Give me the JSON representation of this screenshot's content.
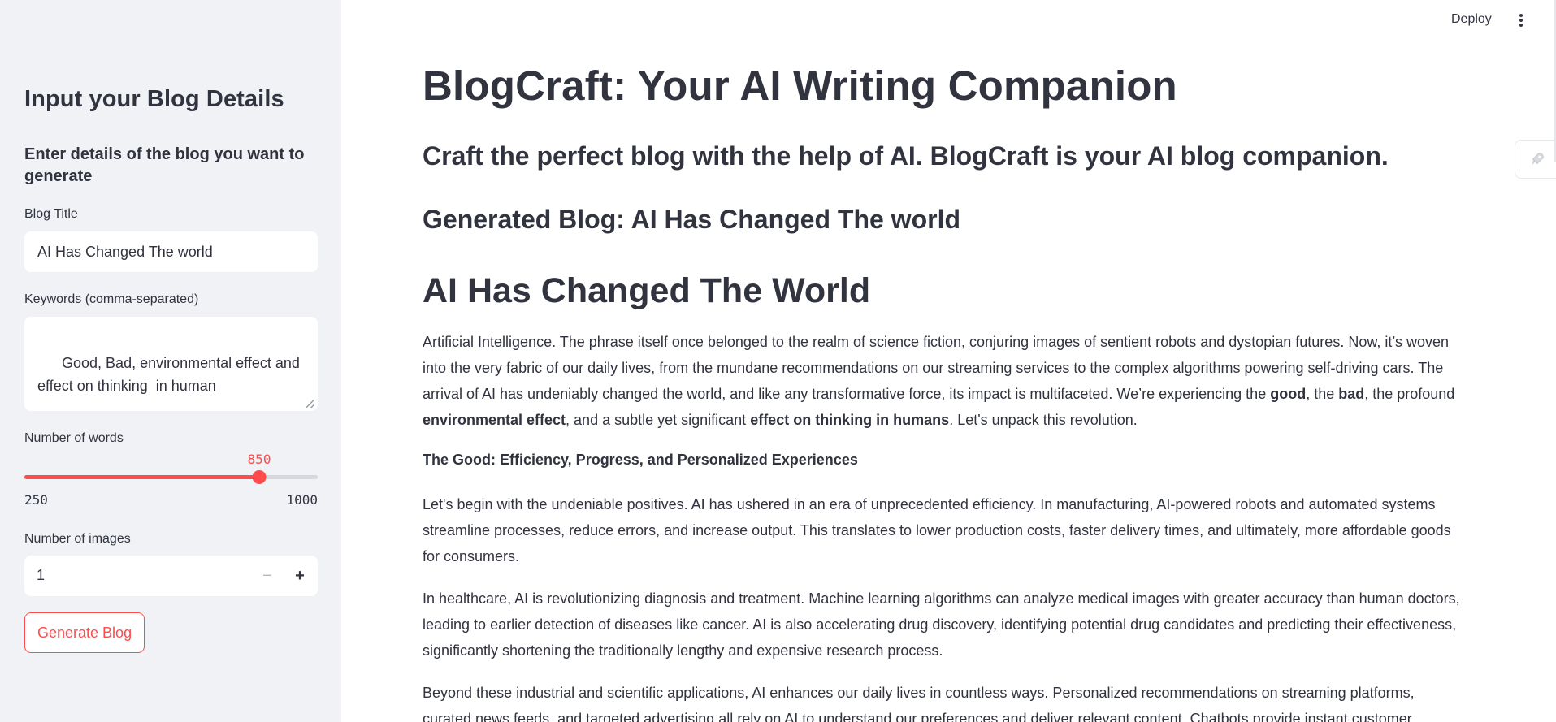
{
  "sidebar": {
    "title": "Input your Blog Details",
    "subtitle": "Enter details of the blog you want to generate",
    "blog_title_label": "Blog Title",
    "blog_title_value": "AI Has Changed The world",
    "keywords_label": "Keywords (comma-separated)",
    "keywords_value": "Good, Bad, environmental effect and effect on thinking  in human",
    "words_label": "Number of words",
    "words_value": "850",
    "words_min": "250",
    "words_max": "1000",
    "words_level": 0.8,
    "images_label": "Number of images",
    "images_value": "1",
    "minus_symbol": "−",
    "plus_symbol": "+",
    "generate_label": "Generate Blog"
  },
  "header": {
    "deploy_label": "Deploy",
    "menu_icon": "kebab-menu-icon",
    "side_icon": "rocket-icon"
  },
  "main": {
    "title": "BlogCraft: Your AI Writing Companion",
    "tagline": "Craft the perfect blog with the help of AI. BlogCraft is your AI blog companion.",
    "generated_heading": "Generated Blog: AI Has Changed The world",
    "blog_title": "AI Has Changed The World",
    "intro": {
      "part1": "Artificial Intelligence. The phrase itself once belonged to the realm of science fiction, conjuring images of sentient robots and dystopian futures. Now, it’s woven into the very fabric of our daily lives, from the mundane recommendations on our streaming services to the complex algorithms powering self-driving cars. The arrival of AI has undeniably changed the world, and like any transformative force, its impact is multifaceted. We’re experiencing the ",
      "good": "good",
      "part2": ", the ",
      "bad": "bad",
      "part3": ", the profound ",
      "env": "environmental effect",
      "part4": ", and a subtle yet significant ",
      "thinking": "effect on thinking in humans",
      "part5": ". Let's unpack this revolution."
    },
    "section_good_heading": "The Good: Efficiency, Progress, and Personalized Experiences",
    "para_efficiency": "Let's begin with the undeniable positives. AI has ushered in an era of unprecedented efficiency. In manufacturing, AI-powered robots and automated systems streamline processes, reduce errors, and increase output. This translates to lower production costs, faster delivery times, and ultimately, more affordable goods for consumers.",
    "para_healthcare": "In healthcare, AI is revolutionizing diagnosis and treatment. Machine learning algorithms can analyze medical images with greater accuracy than human doctors, leading to earlier detection of diseases like cancer. AI is also accelerating drug discovery, identifying potential drug candidates and predicting their effectiveness, significantly shortening the traditionally lengthy and expensive research process.",
    "para_daily": "Beyond these industrial and scientific applications, AI enhances our daily lives in countless ways. Personalized recommendations on streaming platforms, curated news feeds, and targeted advertising all rely on AI to understand our preferences and deliver relevant content. Chatbots provide instant customer"
  },
  "colors": {
    "accent": "#ff4b4b",
    "sidebar_bg": "#f0f2f6",
    "text": "#31333f"
  }
}
